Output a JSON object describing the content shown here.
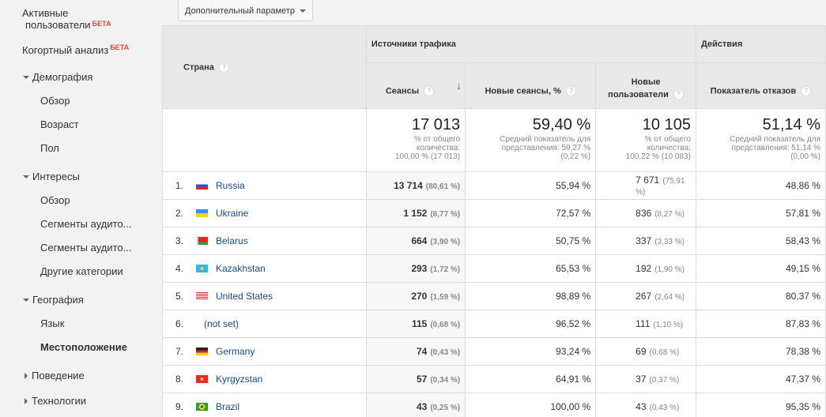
{
  "sidebar": {
    "items": [
      {
        "label": "Активные пользователи",
        "line1": "Активные",
        "line2": "пользователи",
        "badge": "БЕТА"
      },
      {
        "label": "Когортный анализ",
        "badge": "БЕТА"
      },
      {
        "label": "Демография",
        "expanded": true
      },
      {
        "label": "Обзор"
      },
      {
        "label": "Возраст"
      },
      {
        "label": "Пол"
      },
      {
        "label": "Интересы",
        "expanded": true
      },
      {
        "label": "Обзор"
      },
      {
        "label": "Сегменты аудито..."
      },
      {
        "label": "Сегменты аудито..."
      },
      {
        "label": "Другие категории"
      },
      {
        "label": "География",
        "expanded": true
      },
      {
        "label": "Язык"
      },
      {
        "label": "Местоположение",
        "active": true
      },
      {
        "label": "Поведение",
        "expanded": false
      },
      {
        "label": "Технологии",
        "expanded": false
      }
    ]
  },
  "toolbar": {
    "secondary_dimension_label": "Дополнительный параметр"
  },
  "table": {
    "dimension_header": "Страна",
    "groups": {
      "acquisition": "Источники трафика",
      "behavior": "Действия"
    },
    "columns": {
      "sessions": "Сеансы",
      "new_sessions": "Новые сеансы, %",
      "new_users_l1": "Новые",
      "new_users_l2": "пользователи",
      "bounce_rate": "Показатель отказов"
    },
    "totals": {
      "sessions": {
        "value": "17 013",
        "l1": "% от общего",
        "l2": "количества:",
        "l3": "100,00 % (17 013)"
      },
      "new_sessions": {
        "value": "59,40 %",
        "l1": "Средний показатель для",
        "l2": "представления: 59,27 %",
        "l3": "(0,22 %)"
      },
      "new_users": {
        "value": "10 105",
        "l1": "% от общего",
        "l2": "количества:",
        "l3": "100,22 % (10 083)"
      },
      "bounce_rate": {
        "value": "51,14 %",
        "l1": "Средний показатель для",
        "l2": "представления: 51,14 %",
        "l3": "(0,00 %)"
      }
    },
    "rows": [
      {
        "idx": "1.",
        "country": "Russia",
        "flag": "ru",
        "sessions": "13 714",
        "sessions_pct": "(80,61 %)",
        "new_sessions": "55,94 %",
        "new_users": "7 671",
        "new_users_pct": "(75,91 %)",
        "bounce_rate": "48,86 %"
      },
      {
        "idx": "2.",
        "country": "Ukraine",
        "flag": "ua",
        "sessions": "1 152",
        "sessions_pct": "(6,77 %)",
        "new_sessions": "72,57 %",
        "new_users": "836",
        "new_users_pct": "(8,27 %)",
        "bounce_rate": "57,81 %"
      },
      {
        "idx": "3.",
        "country": "Belarus",
        "flag": "by",
        "sessions": "664",
        "sessions_pct": "(3,90 %)",
        "new_sessions": "50,75 %",
        "new_users": "337",
        "new_users_pct": "(3,33 %)",
        "bounce_rate": "58,43 %"
      },
      {
        "idx": "4.",
        "country": "Kazakhstan",
        "flag": "kz",
        "sessions": "293",
        "sessions_pct": "(1,72 %)",
        "new_sessions": "65,53 %",
        "new_users": "192",
        "new_users_pct": "(1,90 %)",
        "bounce_rate": "49,15 %"
      },
      {
        "idx": "5.",
        "country": "United States",
        "flag": "us",
        "sessions": "270",
        "sessions_pct": "(1,59 %)",
        "new_sessions": "98,89 %",
        "new_users": "267",
        "new_users_pct": "(2,64 %)",
        "bounce_rate": "80,37 %"
      },
      {
        "idx": "6.",
        "country": "(not set)",
        "flag": "",
        "sessions": "115",
        "sessions_pct": "(0,68 %)",
        "new_sessions": "96,52 %",
        "new_users": "111",
        "new_users_pct": "(1,10 %)",
        "bounce_rate": "87,83 %"
      },
      {
        "idx": "7.",
        "country": "Germany",
        "flag": "de",
        "sessions": "74",
        "sessions_pct": "(0,43 %)",
        "new_sessions": "93,24 %",
        "new_users": "69",
        "new_users_pct": "(0,68 %)",
        "bounce_rate": "78,38 %"
      },
      {
        "idx": "8.",
        "country": "Kyrgyzstan",
        "flag": "kg",
        "sessions": "57",
        "sessions_pct": "(0,34 %)",
        "new_sessions": "64,91 %",
        "new_users": "37",
        "new_users_pct": "(0,37 %)",
        "bounce_rate": "47,37 %"
      },
      {
        "idx": "9.",
        "country": "Brazil",
        "flag": "br",
        "sessions": "43",
        "sessions_pct": "(0,25 %)",
        "new_sessions": "100,00 %",
        "new_users": "43",
        "new_users_pct": "(0,43 %)",
        "bounce_rate": "95,35 %"
      }
    ]
  },
  "icons": {
    "help": "?",
    "sort_desc": "↓"
  },
  "colors": {
    "link": "#1a4b8c",
    "beta": "#dd4b39",
    "header_bg": "#e9e9e9"
  }
}
